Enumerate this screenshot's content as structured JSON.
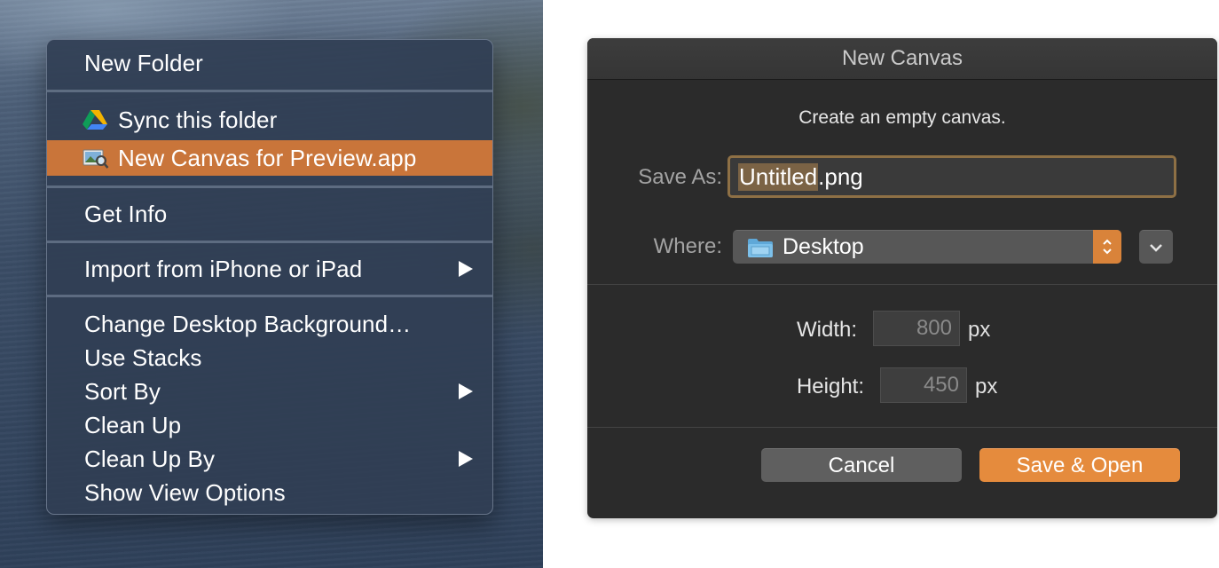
{
  "context_menu": {
    "items": [
      {
        "label": "New Folder"
      },
      {
        "label": "Sync this folder",
        "icon": "google-drive-icon"
      },
      {
        "label": "New Canvas for Preview.app",
        "icon": "preview-app-icon",
        "highlighted": true
      },
      {
        "label": "Get Info"
      },
      {
        "label": "Import from iPhone or iPad",
        "submenu": true
      },
      {
        "label": "Change Desktop Background…"
      },
      {
        "label": "Use Stacks"
      },
      {
        "label": "Sort By",
        "submenu": true
      },
      {
        "label": "Clean Up"
      },
      {
        "label": "Clean Up By",
        "submenu": true
      },
      {
        "label": "Show View Options"
      }
    ],
    "highlight_color": "#c9753a"
  },
  "dialog": {
    "title": "New Canvas",
    "subtitle": "Create an empty canvas.",
    "save_as": {
      "label": "Save As:",
      "value_selected": "Untitled",
      "value_rest": ".png"
    },
    "where": {
      "label": "Where:",
      "value": "Desktop",
      "icon": "folder-icon"
    },
    "width": {
      "label": "Width:",
      "value": "800",
      "unit": "px"
    },
    "height": {
      "label": "Height:",
      "value": "450",
      "unit": "px"
    },
    "buttons": {
      "cancel": "Cancel",
      "primary": "Save & Open"
    },
    "accent_color": "#e58b3d"
  }
}
